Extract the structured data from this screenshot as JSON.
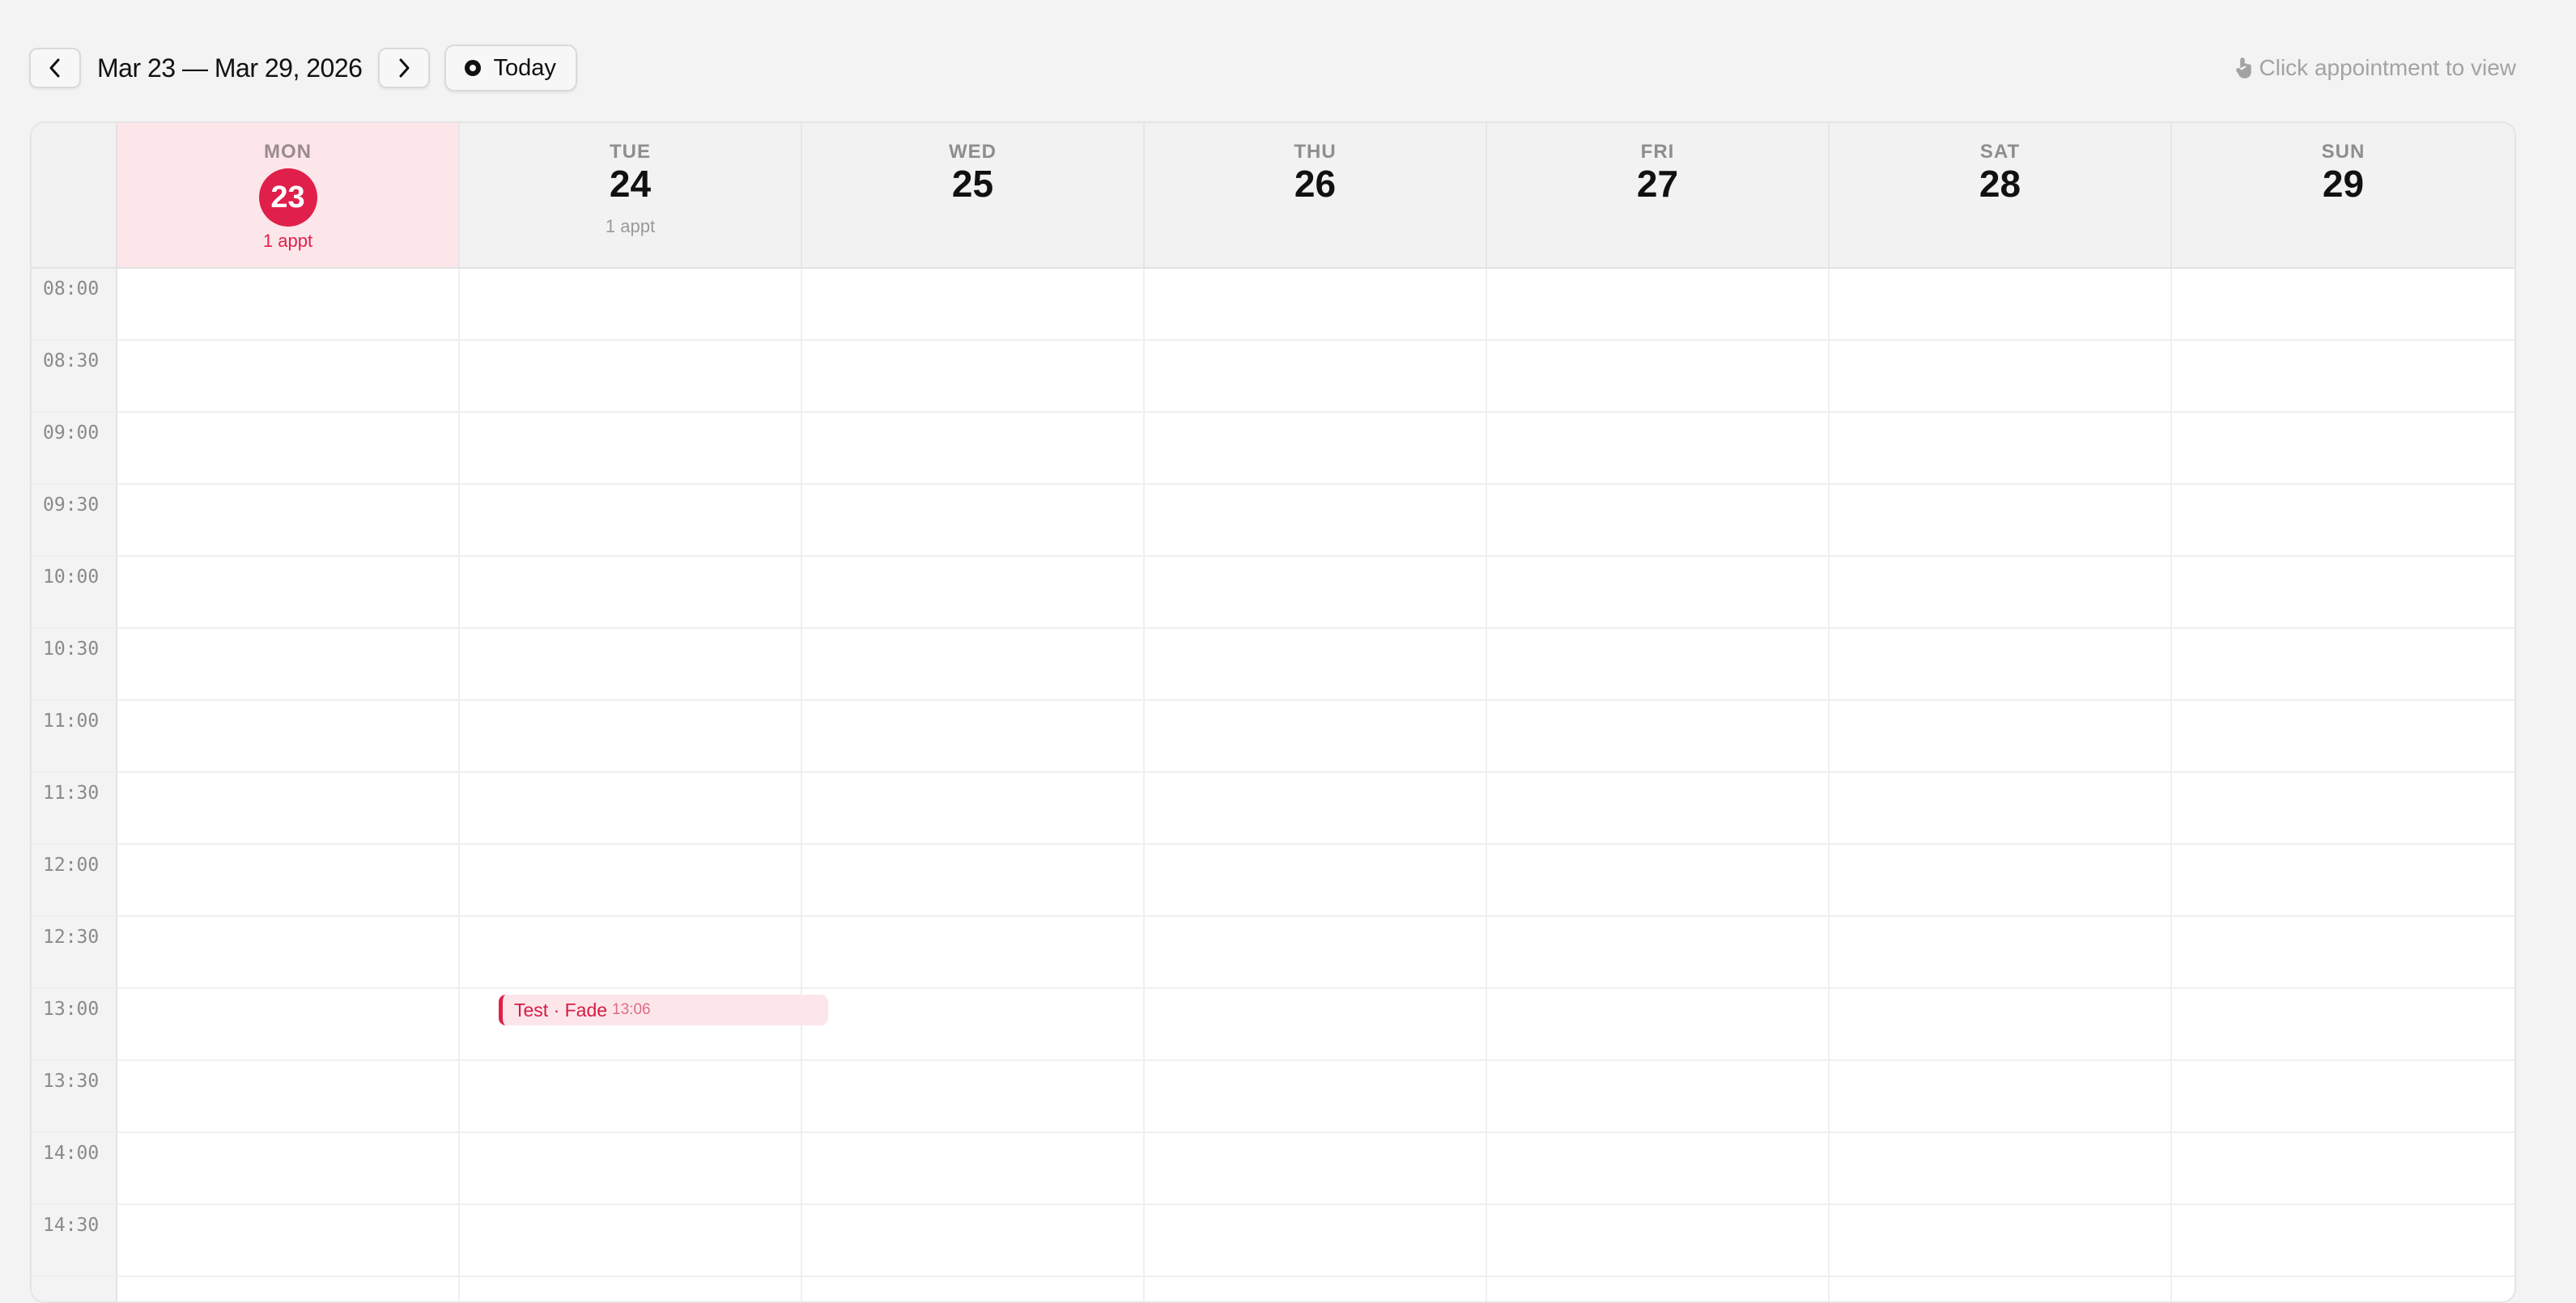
{
  "toolbar": {
    "prev_icon": "chevron-left-icon",
    "next_icon": "chevron-right-icon",
    "range_label": "Mar 23 — Mar 29, 2026",
    "today_icon": "dot-circle-icon",
    "today_label": "Today",
    "hint_icon": "pointer-hand-icon",
    "hint_text": "Click appointment to view"
  },
  "days": [
    {
      "name": "MON",
      "num": "23",
      "appts": "1 appt",
      "today": true
    },
    {
      "name": "TUE",
      "num": "24",
      "appts": "1 appt",
      "today": false
    },
    {
      "name": "WED",
      "num": "25",
      "appts": "",
      "today": false
    },
    {
      "name": "THU",
      "num": "26",
      "appts": "",
      "today": false
    },
    {
      "name": "FRI",
      "num": "27",
      "appts": "",
      "today": false
    },
    {
      "name": "SAT",
      "num": "28",
      "appts": "",
      "today": false
    },
    {
      "name": "SUN",
      "num": "29",
      "appts": "",
      "today": false
    }
  ],
  "time_slots": [
    "08:00",
    "08:30",
    "09:00",
    "09:30",
    "10:00",
    "10:30",
    "11:00",
    "11:30",
    "12:00",
    "12:30",
    "13:00",
    "13:30",
    "14:00",
    "14:30"
  ],
  "appointments": [
    {
      "day": "TUE",
      "title": "Test · Fade",
      "time": "13:06"
    }
  ],
  "colors": {
    "accent": "#e0204b",
    "today_bg": "#fce6ea",
    "page_bg": "#f3f3f3"
  }
}
